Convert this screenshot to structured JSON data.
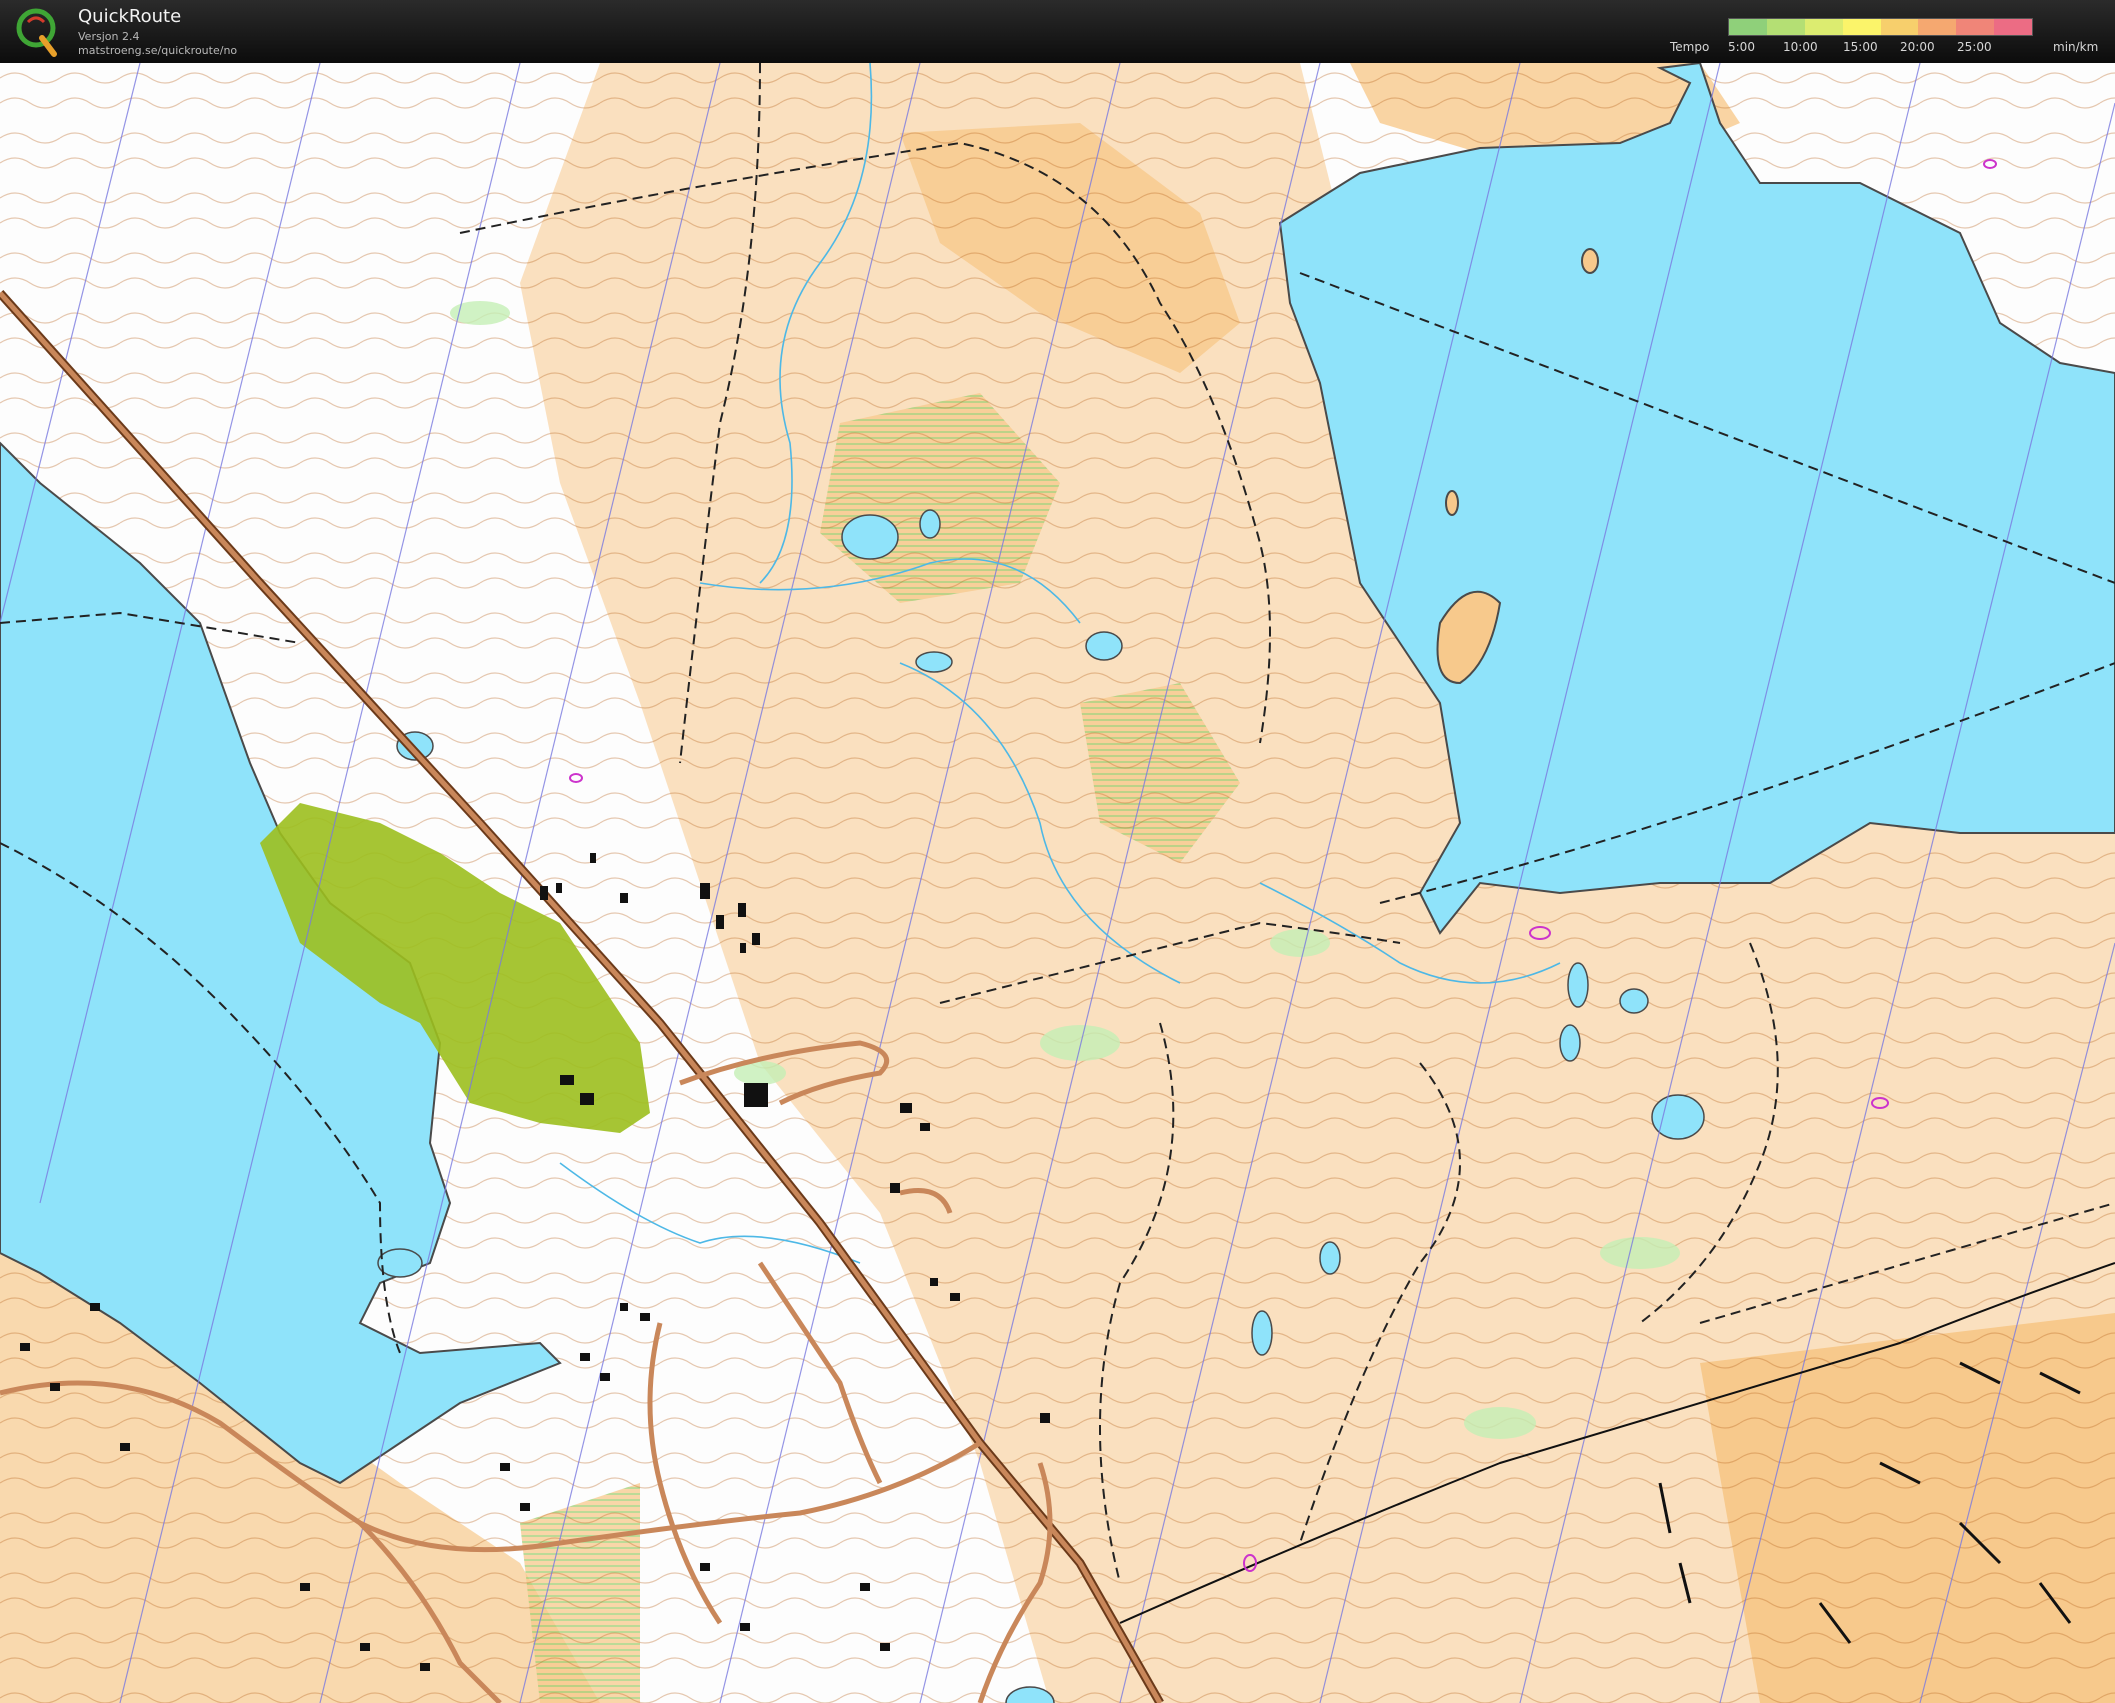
{
  "app": {
    "title": "QuickRoute",
    "version": "Versjon 2.4",
    "url": "matstroeng.se/quickroute/no",
    "logo_letter": "Q"
  },
  "tempo_legend": {
    "label": "Tempo",
    "ticks": [
      "5:00",
      "10:00",
      "15:00",
      "20:00",
      "25:00"
    ],
    "unit": "min/km",
    "gradient_colors": [
      "#8fd07a",
      "#b4df74",
      "#dcec70",
      "#fbf46a",
      "#f7cf6c",
      "#f5a870",
      "#f08578",
      "#ec6c84"
    ]
  },
  "map": {
    "icon": "orienteering-map",
    "colors": {
      "water": "#8fe3fa",
      "open_land": "#f7c98c",
      "rough_open": "#fbe0b6",
      "forest_white": "#fdfdfd",
      "green_vegetation": "#c4efb5",
      "settlement_green": "#9cbf1e",
      "contour": "#b8641f",
      "road": "#c9875a",
      "building": "#111111",
      "magnetic_north_line": "#7a7ae0",
      "path": "#222222",
      "marsh": "#4db8e6"
    }
  }
}
